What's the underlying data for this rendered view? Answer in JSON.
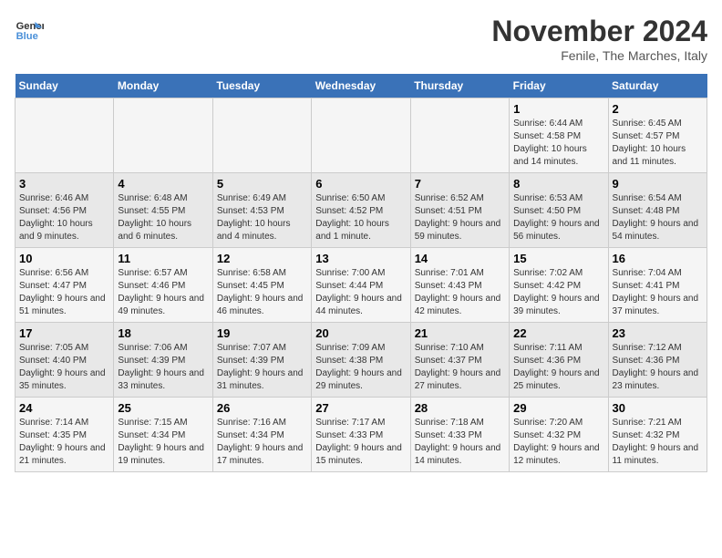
{
  "logo": {
    "line1": "General",
    "line2": "Blue"
  },
  "title": "November 2024",
  "location": "Fenile, The Marches, Italy",
  "days_of_week": [
    "Sunday",
    "Monday",
    "Tuesday",
    "Wednesday",
    "Thursday",
    "Friday",
    "Saturday"
  ],
  "weeks": [
    [
      {
        "day": "",
        "info": ""
      },
      {
        "day": "",
        "info": ""
      },
      {
        "day": "",
        "info": ""
      },
      {
        "day": "",
        "info": ""
      },
      {
        "day": "",
        "info": ""
      },
      {
        "day": "1",
        "info": "Sunrise: 6:44 AM\nSunset: 4:58 PM\nDaylight: 10 hours and 14 minutes."
      },
      {
        "day": "2",
        "info": "Sunrise: 6:45 AM\nSunset: 4:57 PM\nDaylight: 10 hours and 11 minutes."
      }
    ],
    [
      {
        "day": "3",
        "info": "Sunrise: 6:46 AM\nSunset: 4:56 PM\nDaylight: 10 hours and 9 minutes."
      },
      {
        "day": "4",
        "info": "Sunrise: 6:48 AM\nSunset: 4:55 PM\nDaylight: 10 hours and 6 minutes."
      },
      {
        "day": "5",
        "info": "Sunrise: 6:49 AM\nSunset: 4:53 PM\nDaylight: 10 hours and 4 minutes."
      },
      {
        "day": "6",
        "info": "Sunrise: 6:50 AM\nSunset: 4:52 PM\nDaylight: 10 hours and 1 minute."
      },
      {
        "day": "7",
        "info": "Sunrise: 6:52 AM\nSunset: 4:51 PM\nDaylight: 9 hours and 59 minutes."
      },
      {
        "day": "8",
        "info": "Sunrise: 6:53 AM\nSunset: 4:50 PM\nDaylight: 9 hours and 56 minutes."
      },
      {
        "day": "9",
        "info": "Sunrise: 6:54 AM\nSunset: 4:48 PM\nDaylight: 9 hours and 54 minutes."
      }
    ],
    [
      {
        "day": "10",
        "info": "Sunrise: 6:56 AM\nSunset: 4:47 PM\nDaylight: 9 hours and 51 minutes."
      },
      {
        "day": "11",
        "info": "Sunrise: 6:57 AM\nSunset: 4:46 PM\nDaylight: 9 hours and 49 minutes."
      },
      {
        "day": "12",
        "info": "Sunrise: 6:58 AM\nSunset: 4:45 PM\nDaylight: 9 hours and 46 minutes."
      },
      {
        "day": "13",
        "info": "Sunrise: 7:00 AM\nSunset: 4:44 PM\nDaylight: 9 hours and 44 minutes."
      },
      {
        "day": "14",
        "info": "Sunrise: 7:01 AM\nSunset: 4:43 PM\nDaylight: 9 hours and 42 minutes."
      },
      {
        "day": "15",
        "info": "Sunrise: 7:02 AM\nSunset: 4:42 PM\nDaylight: 9 hours and 39 minutes."
      },
      {
        "day": "16",
        "info": "Sunrise: 7:04 AM\nSunset: 4:41 PM\nDaylight: 9 hours and 37 minutes."
      }
    ],
    [
      {
        "day": "17",
        "info": "Sunrise: 7:05 AM\nSunset: 4:40 PM\nDaylight: 9 hours and 35 minutes."
      },
      {
        "day": "18",
        "info": "Sunrise: 7:06 AM\nSunset: 4:39 PM\nDaylight: 9 hours and 33 minutes."
      },
      {
        "day": "19",
        "info": "Sunrise: 7:07 AM\nSunset: 4:39 PM\nDaylight: 9 hours and 31 minutes."
      },
      {
        "day": "20",
        "info": "Sunrise: 7:09 AM\nSunset: 4:38 PM\nDaylight: 9 hours and 29 minutes."
      },
      {
        "day": "21",
        "info": "Sunrise: 7:10 AM\nSunset: 4:37 PM\nDaylight: 9 hours and 27 minutes."
      },
      {
        "day": "22",
        "info": "Sunrise: 7:11 AM\nSunset: 4:36 PM\nDaylight: 9 hours and 25 minutes."
      },
      {
        "day": "23",
        "info": "Sunrise: 7:12 AM\nSunset: 4:36 PM\nDaylight: 9 hours and 23 minutes."
      }
    ],
    [
      {
        "day": "24",
        "info": "Sunrise: 7:14 AM\nSunset: 4:35 PM\nDaylight: 9 hours and 21 minutes."
      },
      {
        "day": "25",
        "info": "Sunrise: 7:15 AM\nSunset: 4:34 PM\nDaylight: 9 hours and 19 minutes."
      },
      {
        "day": "26",
        "info": "Sunrise: 7:16 AM\nSunset: 4:34 PM\nDaylight: 9 hours and 17 minutes."
      },
      {
        "day": "27",
        "info": "Sunrise: 7:17 AM\nSunset: 4:33 PM\nDaylight: 9 hours and 15 minutes."
      },
      {
        "day": "28",
        "info": "Sunrise: 7:18 AM\nSunset: 4:33 PM\nDaylight: 9 hours and 14 minutes."
      },
      {
        "day": "29",
        "info": "Sunrise: 7:20 AM\nSunset: 4:32 PM\nDaylight: 9 hours and 12 minutes."
      },
      {
        "day": "30",
        "info": "Sunrise: 7:21 AM\nSunset: 4:32 PM\nDaylight: 9 hours and 11 minutes."
      }
    ]
  ]
}
